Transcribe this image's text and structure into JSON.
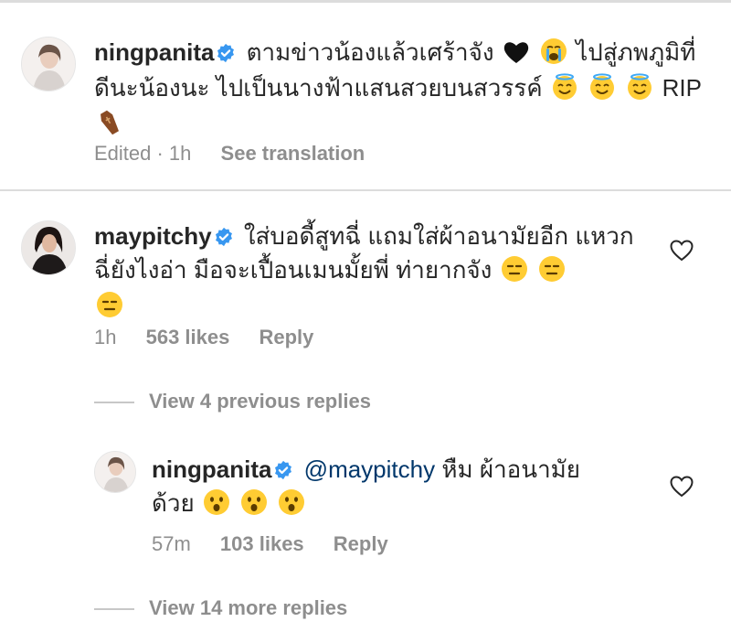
{
  "comments": [
    {
      "username": "ningpanita",
      "text_1": "ตามข่าวน้องแล้วเศร้าจัง",
      "text_2": "ไปสู่ภพภูมิที่",
      "text_3": "ดีนะน้องนะ ไปเป็นนางฟ้าแสนสวยบนสวรรค์",
      "text_4": "RIP",
      "emojis": [
        "black-heart",
        "loudly-crying-face",
        "smiling-face-with-halo",
        "smiling-face-with-halo",
        "smiling-face-with-halo",
        "coffin"
      ],
      "meta_edited": "Edited · 1h",
      "meta_translate": "See translation"
    },
    {
      "username": "maypitchy",
      "text_1": "ใส่บอดี้สูทฉี่ แถมใส่ผ้าอนามัยอีก",
      "text_2": "แหวกฉี่ยังไงอ่า มือจะเปื้อนเมนมั้ยพี่ ท่ายากจัง",
      "emojis": [
        "expressionless-face",
        "expressionless-face",
        "expressionless-face"
      ],
      "meta_time": "1h",
      "meta_likes": "563 likes",
      "meta_reply": "Reply"
    }
  ],
  "view_previous": "View 4 previous replies",
  "reply": {
    "username": "ningpanita",
    "mention": "@maypitchy",
    "text_1": "หืม ผ้าอนามัย",
    "text_2": "ด้วย",
    "emojis": [
      "hushed-face",
      "hushed-face",
      "hushed-face"
    ],
    "meta_time": "57m",
    "meta_likes": "103 likes",
    "meta_reply": "Reply"
  },
  "view_more": "View 14 more replies",
  "colors": {
    "text": "#262626",
    "secondary": "#8e8e8e",
    "mention": "#00376b",
    "verified": "#3897f0",
    "divider": "#dcdcdc"
  }
}
